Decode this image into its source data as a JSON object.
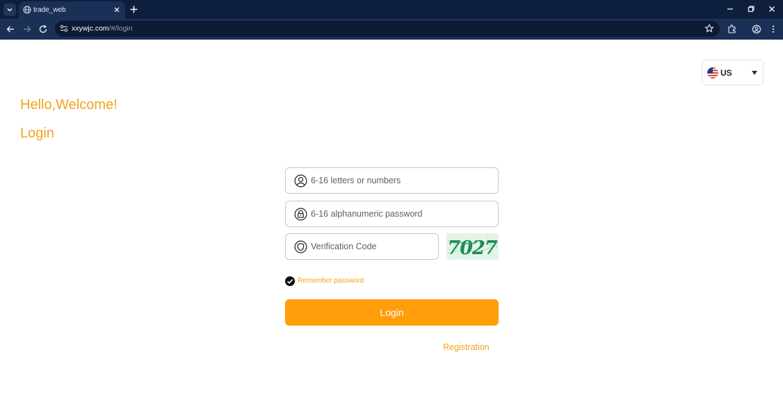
{
  "browser": {
    "tab_title": "trade_web",
    "url_host": "xxywjc.com",
    "url_path": "/#/login"
  },
  "language": {
    "selected": "US"
  },
  "welcome_text": "Hello,Welcome!",
  "login_heading": "Login",
  "form": {
    "username_placeholder": "6-16 letters or numbers",
    "password_placeholder": "6-16 alphanumeric password",
    "code_placeholder": "Verification Code",
    "captcha_text": "7027",
    "remember_label": "Remember password",
    "remember_checked": true,
    "login_button": "Login",
    "register_link": "Registration"
  },
  "colors": {
    "accent": "#f4a21c",
    "button": "#ff9d0b",
    "chrome_dark": "#0d1f3c",
    "chrome_toolbar": "#1b3056"
  },
  "icons": {
    "username": "user-circle-icon",
    "password": "lock-icon",
    "code": "shield-icon"
  }
}
